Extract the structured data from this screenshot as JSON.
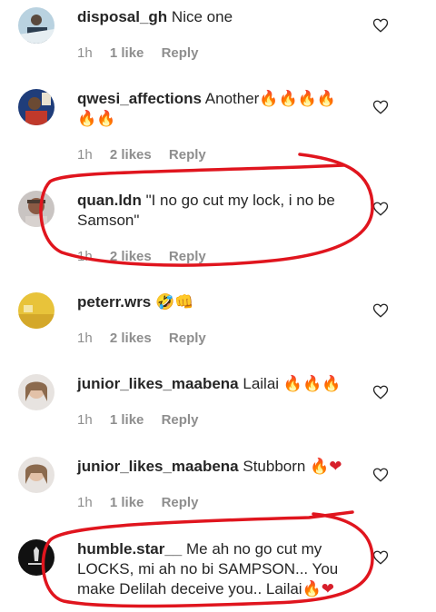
{
  "comments": [
    {
      "username": "disposal_gh",
      "text": "Nice one",
      "emoji": "",
      "time": "1h",
      "likes": "1 like",
      "reply": "Reply"
    },
    {
      "username": "qwesi_affections",
      "text": "Another",
      "emoji": "🔥🔥🔥🔥",
      "emoji2": "🔥🔥",
      "time": "1h",
      "likes": "2 likes",
      "reply": "Reply"
    },
    {
      "username": "quan.ldn",
      "text": "\"I no go cut my lock, i no be",
      "text2": "Samson\"",
      "time": "1h",
      "likes": "2 likes",
      "reply": "Reply"
    },
    {
      "username": "peterr.wrs",
      "text": "",
      "emoji": "🤣👊",
      "time": "1h",
      "likes": "2 likes",
      "reply": "Reply"
    },
    {
      "username": "junior_likes_maabena",
      "text": "Lailai",
      "emoji": "🔥🔥🔥",
      "time": "1h",
      "likes": "1 like",
      "reply": "Reply"
    },
    {
      "username": "junior_likes_maabena",
      "text": "Stubborn",
      "emoji": "🔥",
      "heart": "❤",
      "time": "1h",
      "likes": "1 like",
      "reply": "Reply"
    },
    {
      "username": "humble.star__",
      "text": "Me ah no go cut my",
      "text2": "LOCKS, mi ah no bi SAMPSON... You",
      "text3": "make Delilah deceive you.. Lailai",
      "emoji": "🔥",
      "heart": "❤"
    }
  ],
  "colors": {
    "annotation": "#e0151e",
    "meta": "#8e8e8e"
  },
  "icons": {
    "like": "heart-outline-icon"
  }
}
